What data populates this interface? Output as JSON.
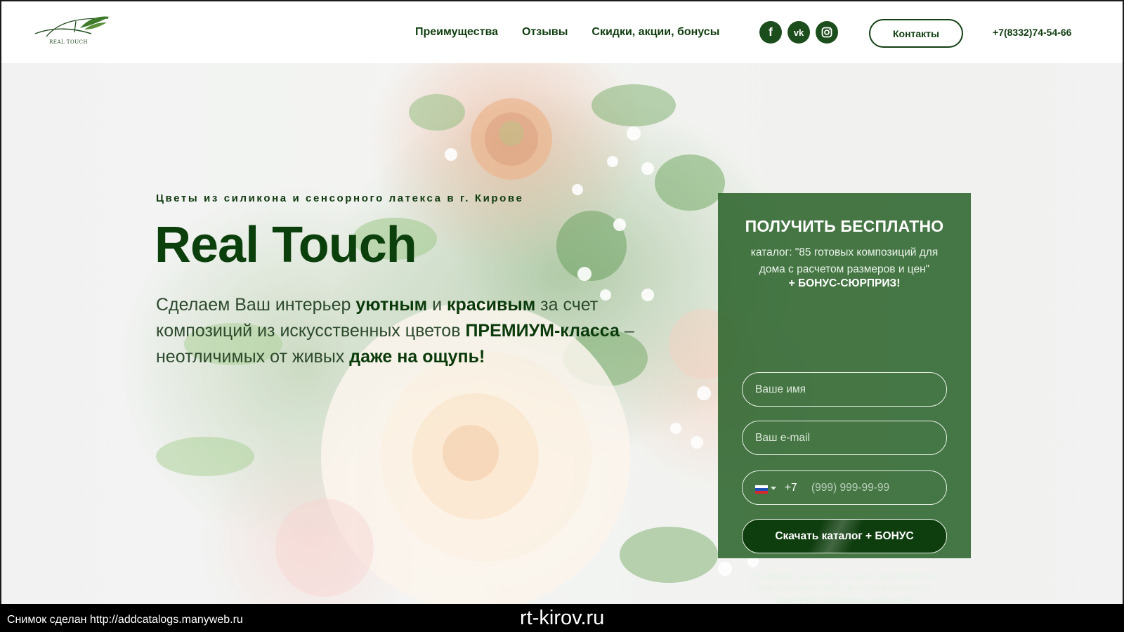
{
  "header": {
    "logo_text": "REAL TOUCH",
    "nav": [
      "Преимущества",
      "Отзывы",
      "Скидки, акции, бонусы"
    ],
    "social": [
      {
        "icon": "facebook-icon",
        "glyph": "f"
      },
      {
        "icon": "vk-icon",
        "glyph": "vk"
      },
      {
        "icon": "instagram-icon",
        "glyph": ""
      }
    ],
    "contacts_label": "Контакты",
    "phone": "+7(8332)74-54-66"
  },
  "hero": {
    "subtitle": "Цветы из силикона и сенсорного латекса в г. Кирове",
    "title": "Real Touch",
    "lead": {
      "p1": "Сделаем Ваш интерьер ",
      "b1": "уютным",
      "p2": " и ",
      "b2": "красивым",
      "p3": " за счет композиций из искусственных цветов ",
      "b3": "ПРЕМИУМ-класса",
      "p4": " – неотличимых от живых ",
      "b4": "даже на ощупь!"
    }
  },
  "form": {
    "title": "ПОЛУЧИТЬ БЕСПЛАТНО",
    "description": "каталог: \"85 готовых композиций для дома с расчетом размеров и цен\"",
    "bonus": "+ БОНУС-СЮРПРИЗ!",
    "name_placeholder": "Ваше имя",
    "email_placeholder": "Ваш e-mail",
    "phone_country_code": "+7",
    "phone_placeholder": "(999) 999-99-99",
    "submit_label": "Скачать каталог + БОНУС",
    "legal_text": "Нажимая, вы даете согласие на обработку персональных данных и соглашаетесь с",
    "legal_link": "политикой конфиденциальности"
  },
  "footer": {
    "capture_note": "Снимок сделан http://addcatalogs.manyweb.ru",
    "domain": "rt-kirov.ru"
  },
  "colors": {
    "brand_green": "#0b3f0b",
    "panel_green": "#2c642c",
    "button_dark": "#0e3d0e"
  }
}
